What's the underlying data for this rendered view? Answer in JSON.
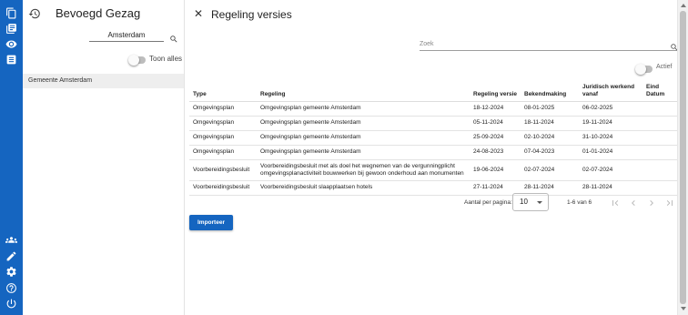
{
  "rail": {
    "top_icons": [
      "copy-icon",
      "library-icon",
      "eye-icon",
      "document-icon"
    ],
    "bottom_icons": [
      "people-icon",
      "pencil-icon",
      "settings-icon",
      "help-icon",
      "power-icon"
    ]
  },
  "left": {
    "title": "Bevoegd Gezag",
    "search_value": "Amsterdam",
    "toggle_label": "Toon alles",
    "items": [
      "Gemeente Amsterdam"
    ]
  },
  "panel": {
    "title": "Regeling versies",
    "search_placeholder": "Zoek",
    "toggle_label": "Actief",
    "columns": [
      "Type",
      "Regeling",
      "Regeling versie",
      "Bekendmaking",
      "Juridisch werkend vanaf",
      "Eind Datum"
    ],
    "rows": [
      [
        "Omgevingsplan",
        "Omgevingsplan gemeente Amsterdam",
        "18-12-2024",
        "08-01-2025",
        "06-02-2025",
        ""
      ],
      [
        "Omgevingsplan",
        "Omgevingsplan gemeente Amsterdam",
        "05-11-2024",
        "18-11-2024",
        "19-11-2024",
        ""
      ],
      [
        "Omgevingsplan",
        "Omgevingsplan gemeente Amsterdam",
        "25-09-2024",
        "02-10-2024",
        "31-10-2024",
        ""
      ],
      [
        "Omgevingsplan",
        "Omgevingsplan gemeente Amsterdam",
        "24-08-2023",
        "07-04-2023",
        "01-01-2024",
        ""
      ],
      [
        "Voorbereidingsbesluit",
        "Voorbereidingsbesluit met als doel het wegnemen van de vergunningplicht omgevingsplanactiviteit bouwwerken bij gewoon onderhoud aan monumenten",
        "19-06-2024",
        "02-07-2024",
        "02-07-2024",
        ""
      ],
      [
        "Voorbereidingsbesluit",
        "Voorbereidingsbesluit slaapplaatsen hotels",
        "27-11-2024",
        "28-11-2024",
        "28-11-2024",
        ""
      ]
    ],
    "pagination": {
      "label": "Aantal per pagina:",
      "page_size": "10",
      "range": "1-6 van 6"
    },
    "import_label": "Importeer"
  }
}
